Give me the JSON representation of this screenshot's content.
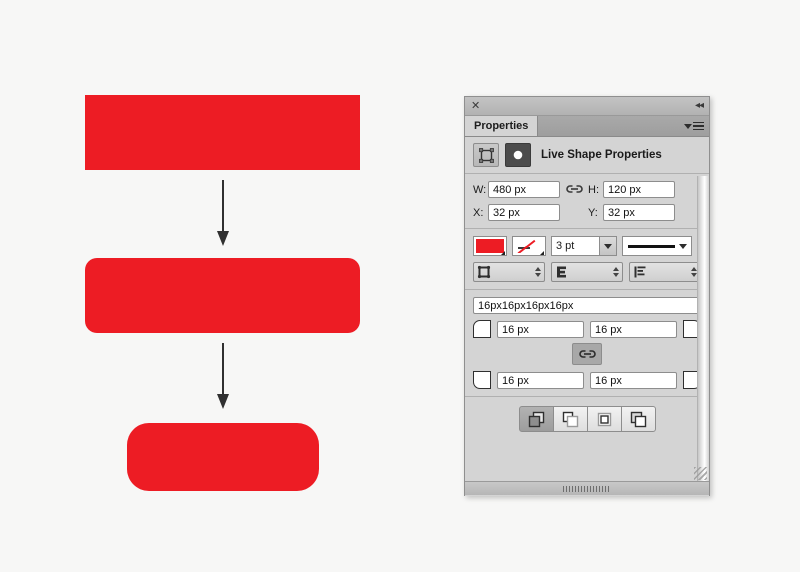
{
  "canvas": {
    "shapes": [
      {
        "name": "rect-sharp",
        "fill": "#ed1c24",
        "radius": "0 px"
      },
      {
        "name": "rect-rounded-medium",
        "fill": "#ed1c24",
        "radius": "12 px"
      },
      {
        "name": "rect-rounded-large",
        "fill": "#ed1c24",
        "radius": "22 px"
      }
    ],
    "background": "#f7f7f6"
  },
  "panel": {
    "close_label": "✕",
    "collapse_label": "◂◂",
    "tab_label": "Properties",
    "header": {
      "title": "Live Shape Properties",
      "shape_icon": "live-shape-icon",
      "ellipse_icon": "ellipse-icon"
    },
    "dimensions": {
      "w_label": "W:",
      "w_value": "480 px",
      "h_label": "H:",
      "h_value": "120 px",
      "x_label": "X:",
      "x_value": "32 px",
      "y_label": "Y:",
      "y_value": "32 px",
      "link_icon": "link-icon"
    },
    "appearance": {
      "fill_color": "#ed1c24",
      "fill_swatch_name": "fill-swatch",
      "stroke_swatch_name": "stroke-none-swatch",
      "stroke_weight": "3 pt",
      "stroke_style_name": "stroke-style-preview",
      "cap_icon": "stroke-cap-icon",
      "join_icon": "stroke-join-icon",
      "align_icon": "stroke-align-icon"
    },
    "corners": {
      "summary_value": "16px16px16px16px",
      "top_left": "16 px",
      "top_right": "16 px",
      "bottom_left": "16 px",
      "bottom_right": "16 px",
      "link_icon": "link-corners-icon"
    },
    "arrange": {
      "buttons": [
        {
          "name": "bring-to-front",
          "selected": true
        },
        {
          "name": "bring-forward",
          "selected": false
        },
        {
          "name": "send-backward",
          "selected": false
        },
        {
          "name": "send-to-back",
          "selected": false
        }
      ]
    }
  }
}
